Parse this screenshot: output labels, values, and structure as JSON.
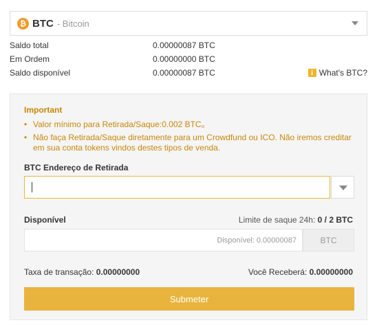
{
  "coin": {
    "icon": "bitcoin-icon",
    "icon_glyph": "₿",
    "symbol": "BTC",
    "name": "- Bitcoin"
  },
  "balances": [
    {
      "label": "Saldo total",
      "value": "0.00000087 BTC"
    },
    {
      "label": "Em Ordem",
      "value": "0.00000000 BTC"
    },
    {
      "label": "Saldo disponível",
      "value": "0.00000087 BTC"
    }
  ],
  "whats_link": "What's BTC?",
  "important": {
    "title": "Important",
    "notes": [
      "Valor mínimo para Retirada/Saque:0.002 BTC。",
      "Não faça Retirada/Saque diretamente para um Crowdfund ou ICO. Não iremos creditar em sua conta tokens vindos destes tipos de venda."
    ]
  },
  "address": {
    "label": "BTC Endereço de Retirada",
    "value": ""
  },
  "available": {
    "label": "Disponível",
    "limit_label": "Limite de saque 24h:",
    "limit_value": "0 / 2 BTC",
    "placeholder": "Disponível: 0.00000087",
    "unit": "BTC"
  },
  "fee": {
    "label": "Taxa de transação:",
    "value": "0.00000000"
  },
  "receive": {
    "label": "Você Receberá:",
    "value": "0.00000000"
  },
  "submit_label": "Submeter",
  "colors": {
    "accent": "#e8b43e",
    "warning_text": "#c8860a",
    "coin": "#f39a2b"
  }
}
